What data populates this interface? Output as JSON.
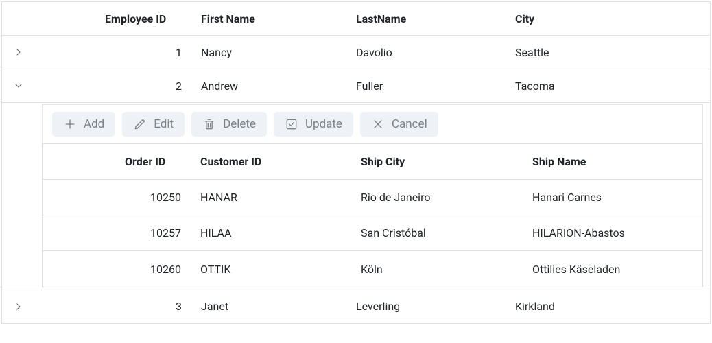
{
  "parent_grid": {
    "headers": {
      "employee_id": "Employee ID",
      "first_name": "First Name",
      "last_name": "LastName",
      "city": "City"
    },
    "rows": [
      {
        "expanded": false,
        "employee_id": "1",
        "first_name": "Nancy",
        "last_name": "Davolio",
        "city": "Seattle"
      },
      {
        "expanded": true,
        "employee_id": "2",
        "first_name": "Andrew",
        "last_name": "Fuller",
        "city": "Tacoma"
      },
      {
        "expanded": false,
        "employee_id": "3",
        "first_name": "Janet",
        "last_name": "Leverling",
        "city": "Kirkland"
      }
    ]
  },
  "toolbar": {
    "add_label": "Add",
    "edit_label": "Edit",
    "delete_label": "Delete",
    "update_label": "Update",
    "cancel_label": "Cancel"
  },
  "child_grid": {
    "headers": {
      "order_id": "Order ID",
      "customer_id": "Customer ID",
      "ship_city": "Ship City",
      "ship_name": "Ship Name"
    },
    "rows": [
      {
        "order_id": "10250",
        "customer_id": "HANAR",
        "ship_city": "Rio de Janeiro",
        "ship_name": "Hanari Carnes"
      },
      {
        "order_id": "10257",
        "customer_id": "HILAA",
        "ship_city": "San Cristóbal",
        "ship_name": "HILARION-Abastos"
      },
      {
        "order_id": "10260",
        "customer_id": "OTTIK",
        "ship_city": "Köln",
        "ship_name": "Ottilies Käseladen"
      }
    ]
  }
}
